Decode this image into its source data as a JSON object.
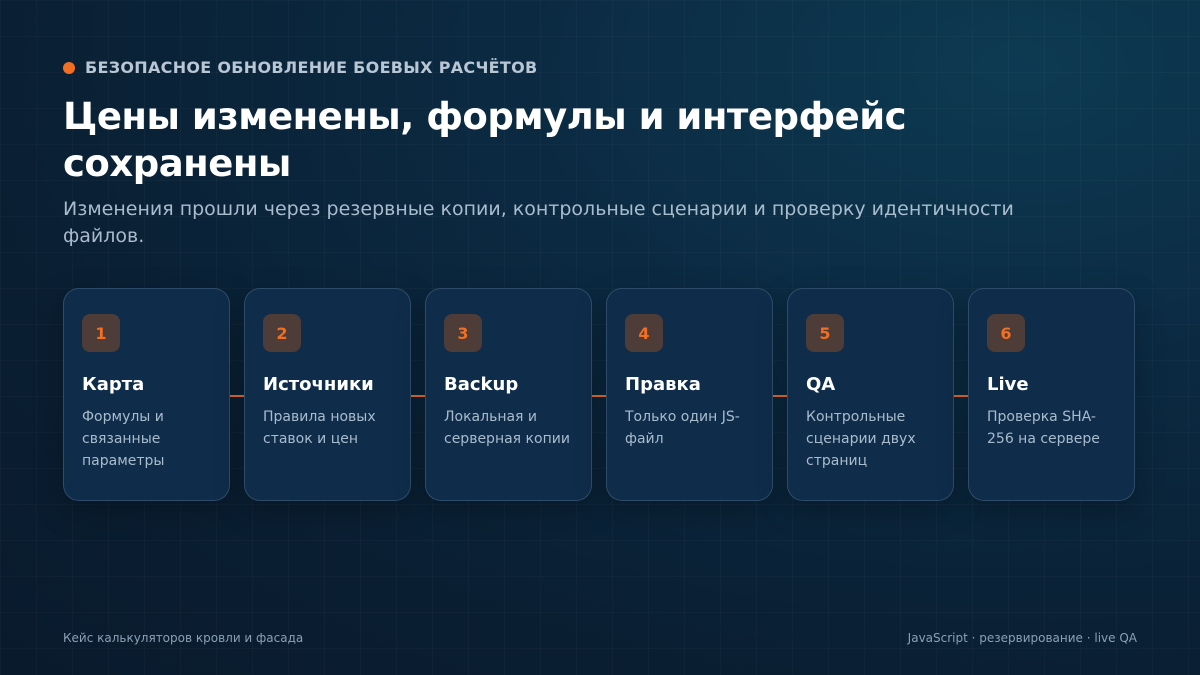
{
  "header": {
    "eyebrow": "Безопасное обновление боевых расчётов",
    "title": "Цены изменены, формулы и интерфейс сохранены",
    "subtitle": "Изменения прошли через резервные копии, контрольные сценарии и проверку идентичности файлов."
  },
  "steps": [
    {
      "number": "1",
      "title": "Карта",
      "description": "Формулы и связанные параметры"
    },
    {
      "number": "2",
      "title": "Источники",
      "description": "Правила новых ставок и цен"
    },
    {
      "number": "3",
      "title": "Backup",
      "description": "Локальная и серверная копии"
    },
    {
      "number": "4",
      "title": "Правка",
      "description": "Только один JS-файл"
    },
    {
      "number": "5",
      "title": "QA",
      "description": "Контрольные сценарии двух страниц"
    },
    {
      "number": "6",
      "title": "Live",
      "description": "Проверка SHA-256 на сервере"
    }
  ],
  "footer": {
    "left": "Кейс калькуляторов кровли и фасада",
    "right": "JavaScript · резервирование · live QA"
  },
  "colors": {
    "accent": "#f26f21",
    "background": "#0a1f33",
    "card": "#0f2c4a"
  }
}
